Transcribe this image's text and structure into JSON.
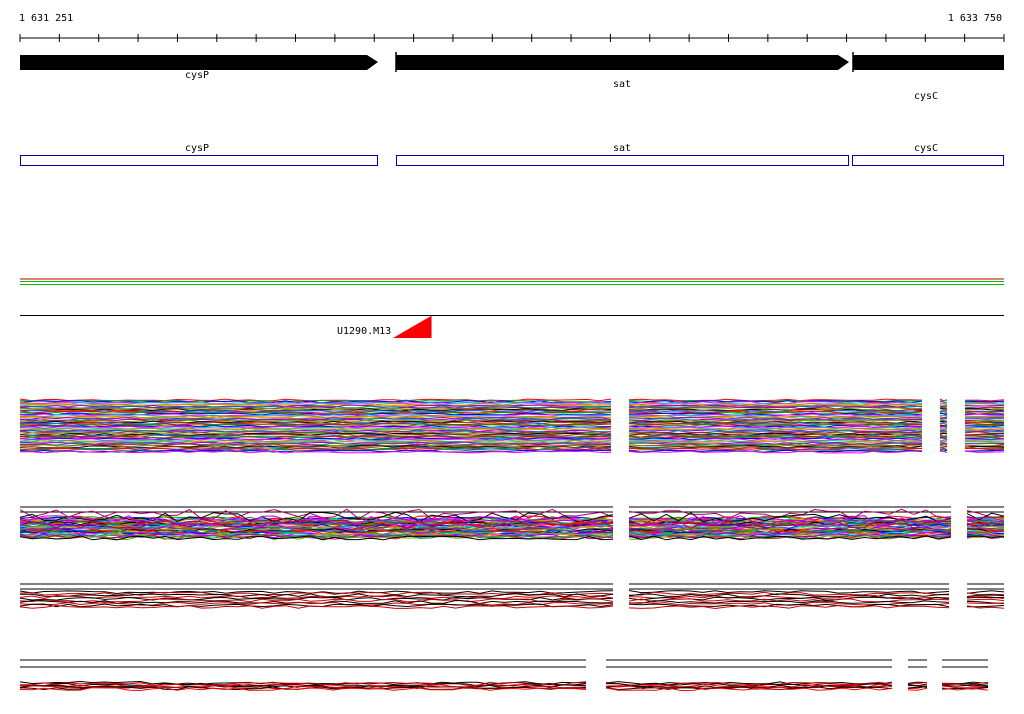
{
  "ruler": {
    "start_label": "1 631 251",
    "end_label": "1 633 750"
  },
  "genes": [
    {
      "name": "cysP",
      "strand": "+"
    },
    {
      "name": "sat",
      "strand": "+"
    },
    {
      "name": "cysC",
      "strand": "+"
    }
  ],
  "features": [
    {
      "name": "cysP"
    },
    {
      "name": "sat"
    },
    {
      "name": "cysC"
    }
  ],
  "primer": {
    "name": "U1290.M13",
    "color": "#ff0000"
  },
  "colors": {
    "gene_arrow": "#000000",
    "feature_box": "#0000aa",
    "track_red": "#cc0000",
    "track_green": "#00bb00"
  }
}
